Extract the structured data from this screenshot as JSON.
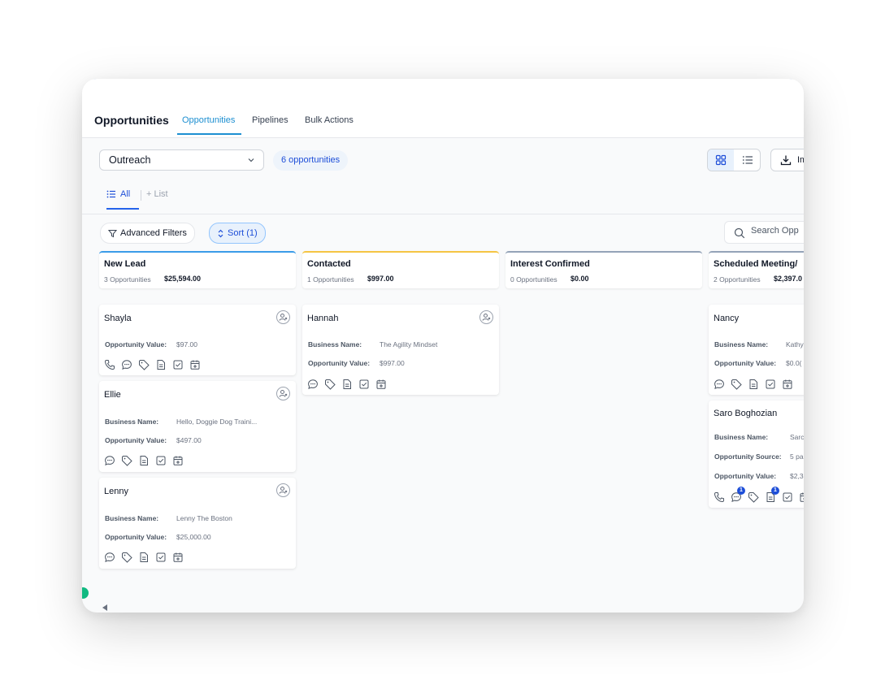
{
  "header": {
    "title": "Opportunities",
    "tabs": [
      {
        "label": "Opportunities",
        "active": true
      },
      {
        "label": "Pipelines",
        "active": false
      },
      {
        "label": "Bulk Actions",
        "active": false
      }
    ]
  },
  "toolbar": {
    "pipeline_select": "Outreach",
    "count_label": "6 opportunities",
    "import_label": "Im"
  },
  "lists": {
    "all_label": "All",
    "add_label": "+ List"
  },
  "filters": {
    "advanced_label": "Advanced Filters",
    "sort_label": "Sort (1)",
    "search_placeholder": "Search Opp"
  },
  "accent_colors": {
    "new_lead": "#3b9ce8",
    "contacted": "#f5c544",
    "interest_confirmed": "#94a3b8",
    "scheduled": "#94a3b8",
    "primary": "#1d4ed8"
  },
  "columns": [
    {
      "name": "New Lead",
      "count": "3 Opportunities",
      "amount": "$25,594.00",
      "cards": [
        {
          "name": "Shayla",
          "fields": [
            {
              "label": "Opportunity Value:",
              "value": "$97.00"
            }
          ],
          "icons": [
            "phone-icon",
            "chat-icon",
            "tag-icon",
            "note-icon",
            "task-icon",
            "calendar-icon"
          ]
        },
        {
          "name": "Ellie",
          "fields": [
            {
              "label": "Business Name:",
              "value": "Hello, Doggie Dog Traini..."
            },
            {
              "label": "Opportunity Value:",
              "value": "$497.00"
            }
          ],
          "icons": [
            "chat-icon",
            "tag-icon",
            "note-icon",
            "task-icon",
            "calendar-icon"
          ]
        },
        {
          "name": "Lenny",
          "fields": [
            {
              "label": "Business Name:",
              "value": "Lenny The Boston"
            },
            {
              "label": "Opportunity Value:",
              "value": "$25,000.00"
            }
          ],
          "icons": [
            "chat-icon",
            "tag-icon",
            "note-icon",
            "task-icon",
            "calendar-icon"
          ]
        }
      ]
    },
    {
      "name": "Contacted",
      "count": "1 Opportunities",
      "amount": "$997.00",
      "cards": [
        {
          "name": "Hannah",
          "fields": [
            {
              "label": "Business Name:",
              "value": "The Agility Mindset"
            },
            {
              "label": "Opportunity Value:",
              "value": "$997.00"
            }
          ],
          "icons": [
            "chat-icon",
            "tag-icon",
            "note-icon",
            "task-icon",
            "calendar-icon"
          ]
        }
      ]
    },
    {
      "name": "Interest Confirmed",
      "count": "0 Opportunities",
      "amount": "$0.00",
      "cards": []
    },
    {
      "name": "Scheduled Meeting/",
      "count": "2 Opportunities",
      "amount": "$2,397.0",
      "cards": [
        {
          "name": "Nancy",
          "fields": [
            {
              "label": "Business Name:",
              "value": "Kathy"
            },
            {
              "label": "Opportunity Value:",
              "value": "$0.0("
            }
          ],
          "icons": [
            "chat-icon",
            "tag-icon",
            "note-icon",
            "task-icon",
            "calendar-icon"
          ]
        },
        {
          "name": "Saro Boghozian",
          "fields": [
            {
              "label": "Business Name:",
              "value": "Sarc"
            },
            {
              "label": "Opportunity Source:",
              "value": "5 pa"
            },
            {
              "label": "Opportunity Value:",
              "value": "$2,3"
            }
          ],
          "icons": [
            "phone-icon",
            "chat-icon",
            "tag-icon",
            "note-icon",
            "task-icon",
            "calendar-icon"
          ],
          "badges": {
            "chat-icon": "1",
            "note-icon": "1"
          }
        }
      ]
    }
  ]
}
